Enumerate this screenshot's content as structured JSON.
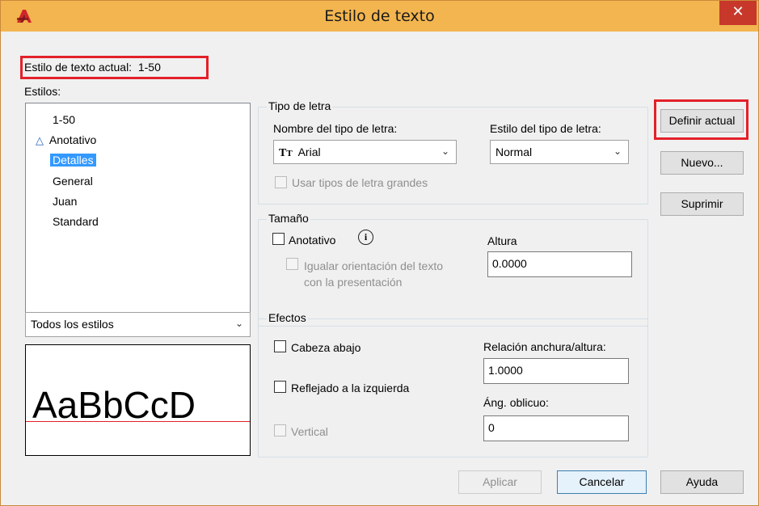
{
  "window": {
    "title": "Estilo de texto",
    "close_glyph": "✕"
  },
  "current_style": {
    "label": "Estilo de texto actual:",
    "value": "1-50"
  },
  "styles": {
    "label": "Estilos:",
    "items": [
      {
        "label": "1-50",
        "annotative": false,
        "selected": false
      },
      {
        "label": "Anotativo",
        "annotative": true,
        "selected": false
      },
      {
        "label": "Detalles",
        "annotative": false,
        "selected": true
      },
      {
        "label": "General",
        "annotative": false,
        "selected": false
      },
      {
        "label": "Juan",
        "annotative": false,
        "selected": false
      },
      {
        "label": "Standard",
        "annotative": false,
        "selected": false
      }
    ],
    "filter": "Todos los estilos"
  },
  "preview": {
    "sample": "AaBbCcD"
  },
  "font": {
    "group_label": "Tipo de letra",
    "name_label": "Nombre del tipo de letra:",
    "name_value": "Arial",
    "style_label": "Estilo del tipo de letra:",
    "style_value": "Normal",
    "bigfont_label": "Usar tipos de letra grandes"
  },
  "size": {
    "group_label": "Tamaño",
    "annotative_label": "Anotativo",
    "match_label_1": "Igualar orientación del texto",
    "match_label_2": "con la presentación",
    "height_label": "Altura",
    "height_value": "0.0000"
  },
  "effects": {
    "group_label": "Efectos",
    "upside_down": "Cabeza abajo",
    "backwards": "Reflejado a la izquierda",
    "vertical": "Vertical",
    "width_factor_label": "Relación anchura/altura:",
    "width_factor_value": "1.0000",
    "oblique_label": "Áng. oblicuo:",
    "oblique_value": "0"
  },
  "buttons": {
    "set_current": "Definir actual",
    "new": "Nuevo...",
    "delete": "Suprimir",
    "apply": "Aplicar",
    "cancel": "Cancelar",
    "help": "Ayuda"
  },
  "colors": {
    "titlebar": "#f3b54f",
    "highlight": "#e3202a",
    "selection": "#3399ff",
    "close": "#c7382b"
  },
  "icons": {
    "app": "autocad-logo-icon",
    "truetype": "truetype-font-icon",
    "info": "info-icon",
    "annotative": "annotative-scale-icon"
  }
}
